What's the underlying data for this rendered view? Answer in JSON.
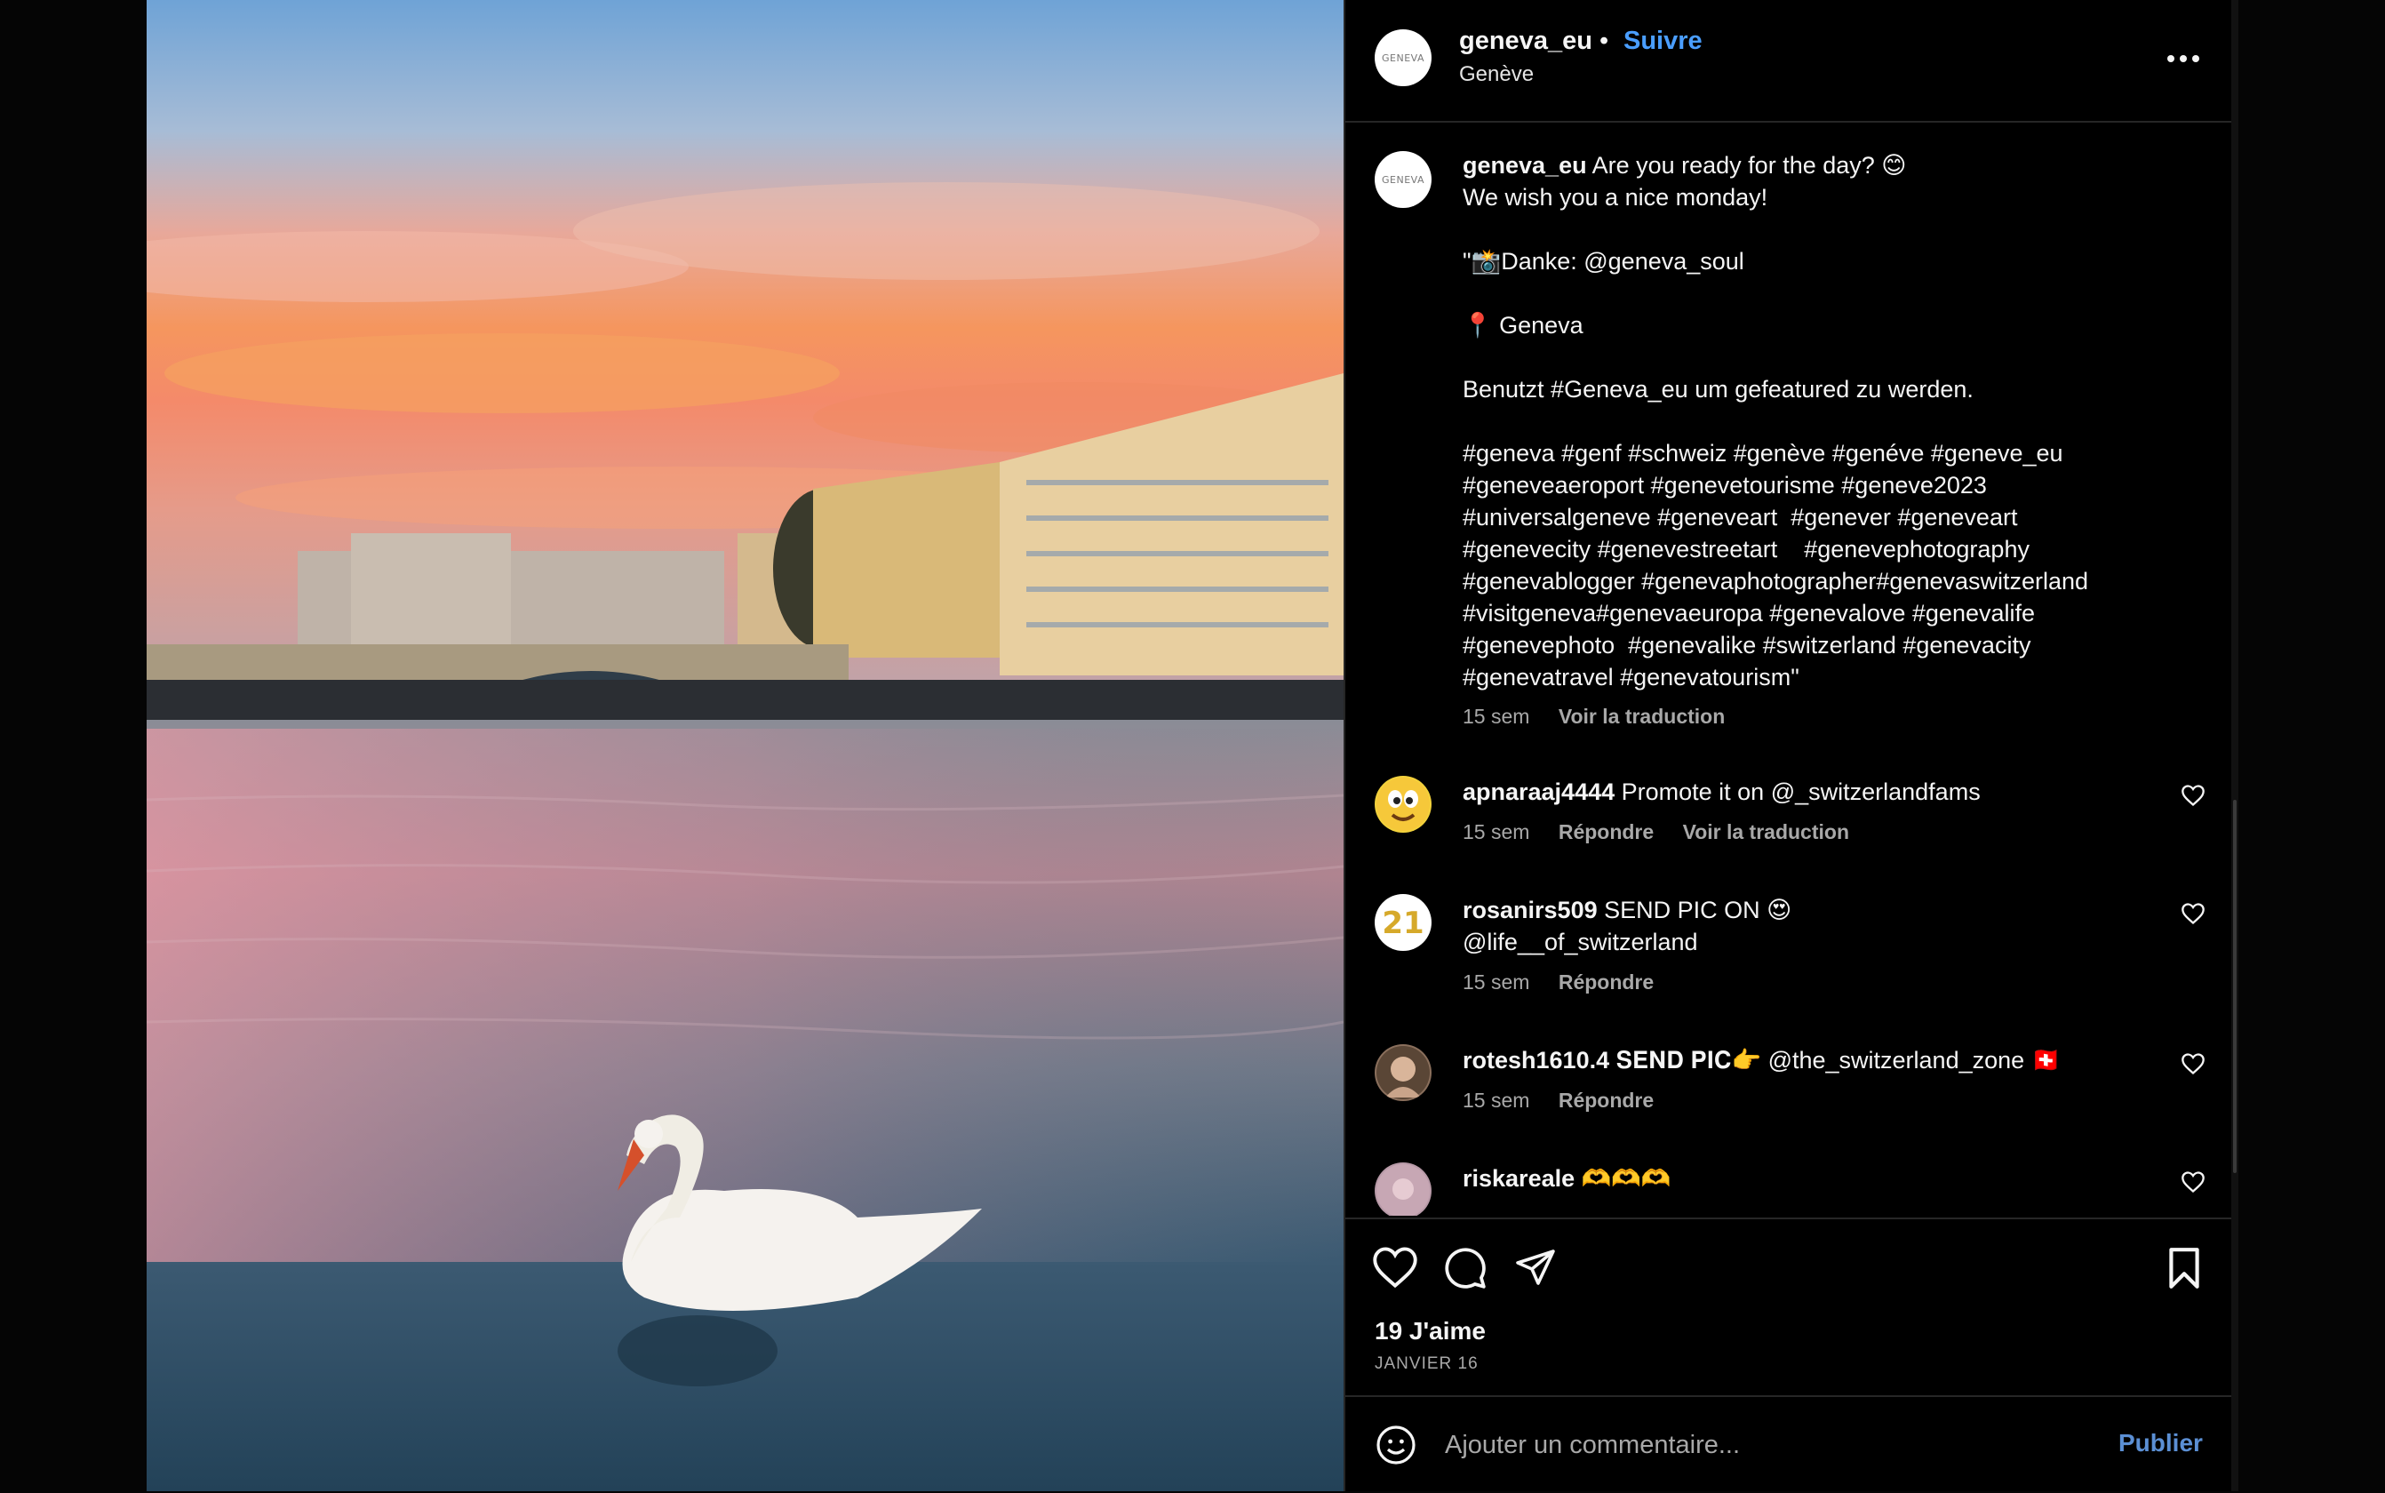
{
  "post": {
    "image_alt_icon": "swan-on-lake-photo",
    "author": {
      "username": "geneva_eu",
      "separator": "•",
      "follow_label": "Suivre",
      "location": "Genève",
      "avatar_text": "GENEVA"
    },
    "caption": {
      "username": "geneva_eu",
      "text": " Are you ready for the day? 😊\nWe wish you a nice monday!\n\n\"📸Danke: @geneva_soul\n\n📍 Geneva\n\nBenutzt #Geneva_eu um gefeatured zu werden.\n\n#geneva #genf #schweiz #genève #genéve #geneve_eu\n#geneveaeroport #genevetourisme #geneve2023\n#universalgeneve #geneveart  #genever #geneveart\n#genevecity #genevestreetart    #genevephotography\n#genevablogger #genevaphotographer#genevaswitzerland\n#visitgeneva#genevaeuropa #genevalove #genevalife\n#genevephoto  #genevalike #switzerland #genevacity\n#genevatravel #genevatourism\"",
      "time": "15 sem",
      "translate": "Voir la traduction"
    },
    "comments": [
      {
        "username": "apnaraaj4444",
        "text": " Promote it on @_switzerlandfams",
        "time": "15 sem",
        "reply": "Répondre",
        "translate": "Voir la traduction"
      },
      {
        "username": "rosanirs509",
        "text": " SEND PIC ON 😍\n@life__of_switzerland",
        "time": "15 sem",
        "reply": "Répondre"
      },
      {
        "username": "rotesh1610.4",
        "text": " 𝐒𝐄𝐍𝐃 𝐏𝐈𝐂👉 @the_switzerland_zone 🇨🇭",
        "time": "15 sem",
        "reply": "Répondre"
      },
      {
        "username": "riskareale",
        "text": " 🫶🫶🫶"
      }
    ],
    "likes": "19 J'aime",
    "date": "JANVIER 16",
    "comment_box": {
      "placeholder": "Ajouter un commentaire...",
      "publish_label": "Publier"
    }
  },
  "colors": {
    "accent_follow": "#4a9eff",
    "publish": "#5b8fd4",
    "background": "#000000",
    "secondary_text": "#a8a8a8"
  }
}
